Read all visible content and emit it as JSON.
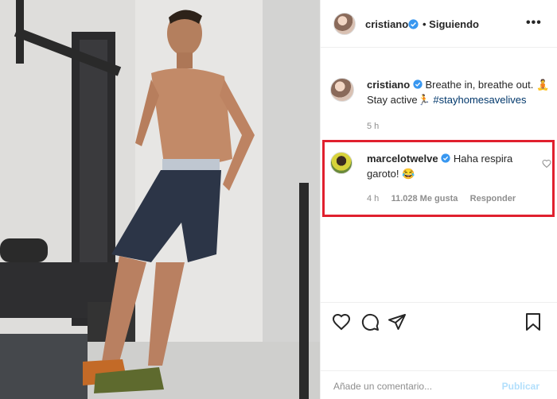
{
  "post": {
    "username": "cristiano",
    "follow_status": "Siguiendo",
    "more": "•••",
    "caption_text_1": "Breathe in, breathe out.",
    "caption_text_2": "Stay active",
    "caption_hashtag": "#stayhomesavelives",
    "time_ago": "5 h"
  },
  "comment": {
    "username": "marcelotwelve",
    "text_1": "Haha respira",
    "text_2": "garoto!",
    "time_ago": "4 h",
    "likes": "11.028 Me gusta",
    "reply": "Responder"
  },
  "composer": {
    "placeholder": "Añade un comentario...",
    "post_label": "Publicar"
  },
  "colors": {
    "highlight": "#e0202e",
    "verified": "#3897f0",
    "hashtag": "#00376b"
  },
  "icons": [
    "heart-icon",
    "comment-icon",
    "share-icon",
    "bookmark-icon",
    "verified-icon",
    "more-icon",
    "emoji-icon"
  ]
}
